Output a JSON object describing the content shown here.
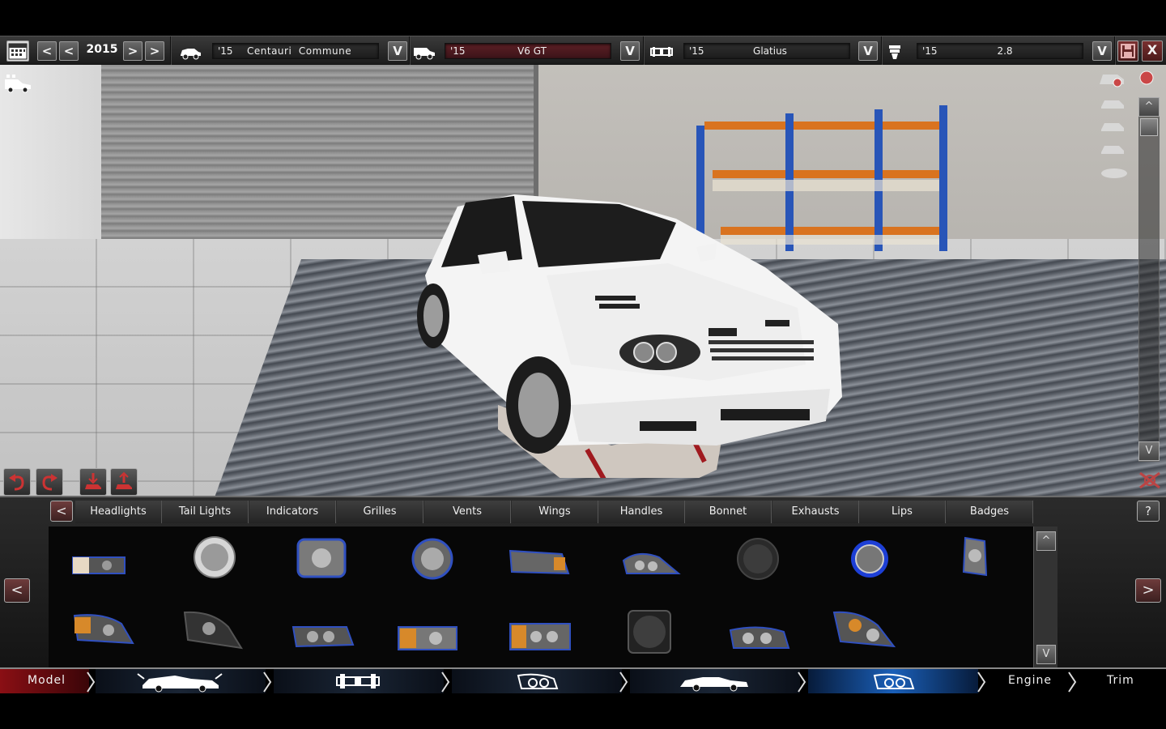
{
  "topbar": {
    "year": "2015",
    "model_year": "'15",
    "model_name": "Centauri  Commune",
    "trim_year": "'15",
    "trim_name": "V6 GT",
    "body_year": "'15",
    "body_name": "Glatius",
    "engine_year": "'15",
    "engine_name": "2.8",
    "dropdown_glyph": "V",
    "prev_glyph": "<",
    "next_glyph": ">",
    "close_glyph": "X"
  },
  "viewport_controls": {
    "scroll_up_glyph": "^",
    "scroll_down_glyph": "V"
  },
  "parts_panel": {
    "prev_tab_glyph": "<",
    "help_glyph": "?",
    "tabs": [
      {
        "label": "Headlights"
      },
      {
        "label": "Tail Lights"
      },
      {
        "label": "Indicators"
      },
      {
        "label": "Grilles"
      },
      {
        "label": "Vents"
      },
      {
        "label": "Wings"
      },
      {
        "label": "Handles"
      },
      {
        "label": "Bonnet"
      },
      {
        "label": "Exhausts"
      },
      {
        "label": "Lips"
      },
      {
        "label": "Badges"
      }
    ],
    "left_glyph": "<",
    "right_glyph": ">",
    "scroll_up_glyph": "^",
    "scroll_down_glyph": "V"
  },
  "bottom_nav": {
    "model_label": "Model",
    "engine_label": "Engine",
    "trim_label": "Trim"
  },
  "colors": {
    "accent_red": "#5c1f25",
    "selected_blue": "#2a6fd6",
    "panel_bg": "#1b1b1b"
  }
}
